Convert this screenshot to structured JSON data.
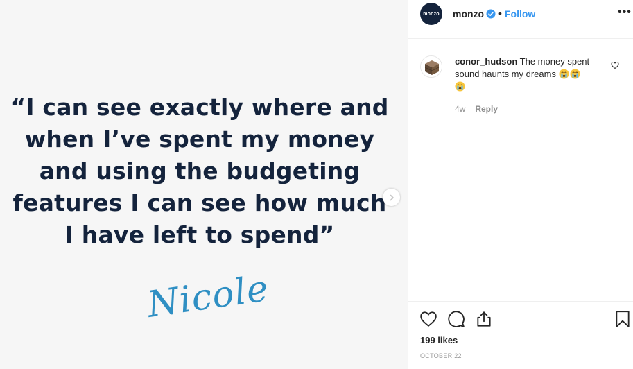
{
  "post": {
    "quote": "“I can see exactly where and when I’ve spent my money and using the budgeting features I can see how much I have left to spend”",
    "signature": "Nicole",
    "next_icon": "chevron-right-icon"
  },
  "header": {
    "avatar_text": "monzo",
    "username": "monzo",
    "separator": "•",
    "follow_label": "Follow",
    "more_label": "•••",
    "verified_color": "#3897f0"
  },
  "comments": [
    {
      "username": "conor_hudson",
      "text": "The money spent sound haunts my dreams",
      "emojis": [
        "crying-face",
        "crying-face",
        "crying-face"
      ],
      "age": "4w",
      "reply_label": "Reply"
    }
  ],
  "actions": {
    "likes": "199 likes",
    "date": "OCTOBER 22"
  },
  "colors": {
    "quote_text": "#14233c",
    "signature": "#2f8fc3",
    "follow": "#3897f0",
    "media_bg": "#f6f6f6"
  }
}
